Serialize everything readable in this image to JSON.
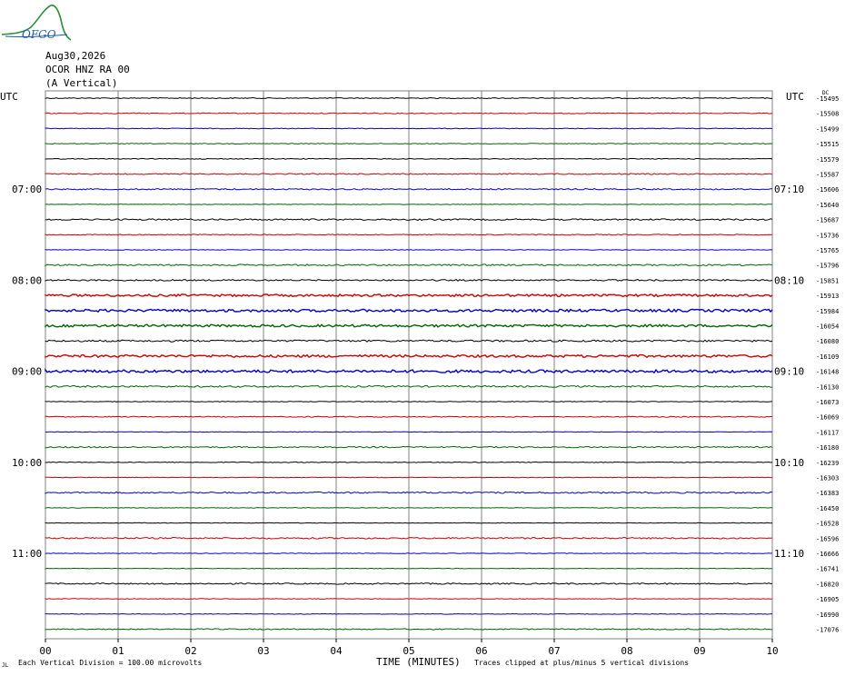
{
  "header": {
    "logo_text": "OFGO",
    "date": "Aug30,2026",
    "station": "OCOR HNZ RA 00",
    "component": "(A Vertical)"
  },
  "axis": {
    "left_label": "UTC",
    "right_label": "UTC",
    "dc_label": "DC",
    "xlabel": "TIME (MINUTES)",
    "xticks": [
      "00",
      "01",
      "02",
      "03",
      "04",
      "05",
      "06",
      "07",
      "08",
      "09",
      "10"
    ]
  },
  "footer": {
    "left_mark": "JL",
    "scale_note": "Each Vertical Division = 100.00 microvolts",
    "clip_note": "Traces clipped at plus/minus 5 vertical divisions"
  },
  "colors": {
    "trace_cycle": [
      "#000000",
      "#cc0000",
      "#0000cc",
      "#006600"
    ],
    "grid": "#808080",
    "logo": "#1f5aa8",
    "logo_hill": "#2e8b3a"
  },
  "chart_data": {
    "type": "line",
    "title": "",
    "xlabel": "TIME (MINUTES)",
    "ylabel": "",
    "xlim": [
      0,
      10
    ],
    "traces_count": 36,
    "left_time_labels": [
      {
        "trace": 6,
        "text": "07:00"
      },
      {
        "trace": 12,
        "text": "08:00"
      },
      {
        "trace": 18,
        "text": "09:00"
      },
      {
        "trace": 24,
        "text": "10:00"
      },
      {
        "trace": 30,
        "text": "11:00"
      }
    ],
    "right_time_labels": [
      {
        "trace": 6,
        "text": "07:10"
      },
      {
        "trace": 12,
        "text": "08:10"
      },
      {
        "trace": 18,
        "text": "09:10"
      },
      {
        "trace": 24,
        "text": "10:10"
      },
      {
        "trace": 30,
        "text": "11:10"
      }
    ],
    "dc_offsets": [
      "-15495",
      "-15508",
      "-15499",
      "-15515",
      "-15579",
      "-15587",
      "-15606",
      "-15640",
      "-15687",
      "-15736",
      "-15765",
      "-15796",
      "-15851",
      "-15913",
      "-15984",
      "-16054",
      "-16080",
      "-16109",
      "-16148",
      "-16130",
      "-16073",
      "-16069",
      "-16117",
      "-16180",
      "-16239",
      "-16303",
      "-16383",
      "-16450",
      "-16528",
      "-16596",
      "-16666",
      "-16741",
      "-16820",
      "-16905",
      "-16990",
      "-17076"
    ],
    "noise_levels": [
      0.5,
      0.5,
      0.4,
      0.4,
      0.4,
      0.6,
      0.7,
      0.3,
      0.8,
      0.5,
      0.3,
      0.8,
      0.8,
      1.2,
      1.4,
      1.3,
      1.0,
      1.3,
      1.5,
      0.9,
      0.3,
      0.5,
      0.3,
      0.7,
      0.4,
      0.3,
      0.8,
      0.3,
      0.3,
      0.8,
      0.3,
      0.3,
      0.7,
      0.3,
      0.3,
      0.6
    ]
  }
}
